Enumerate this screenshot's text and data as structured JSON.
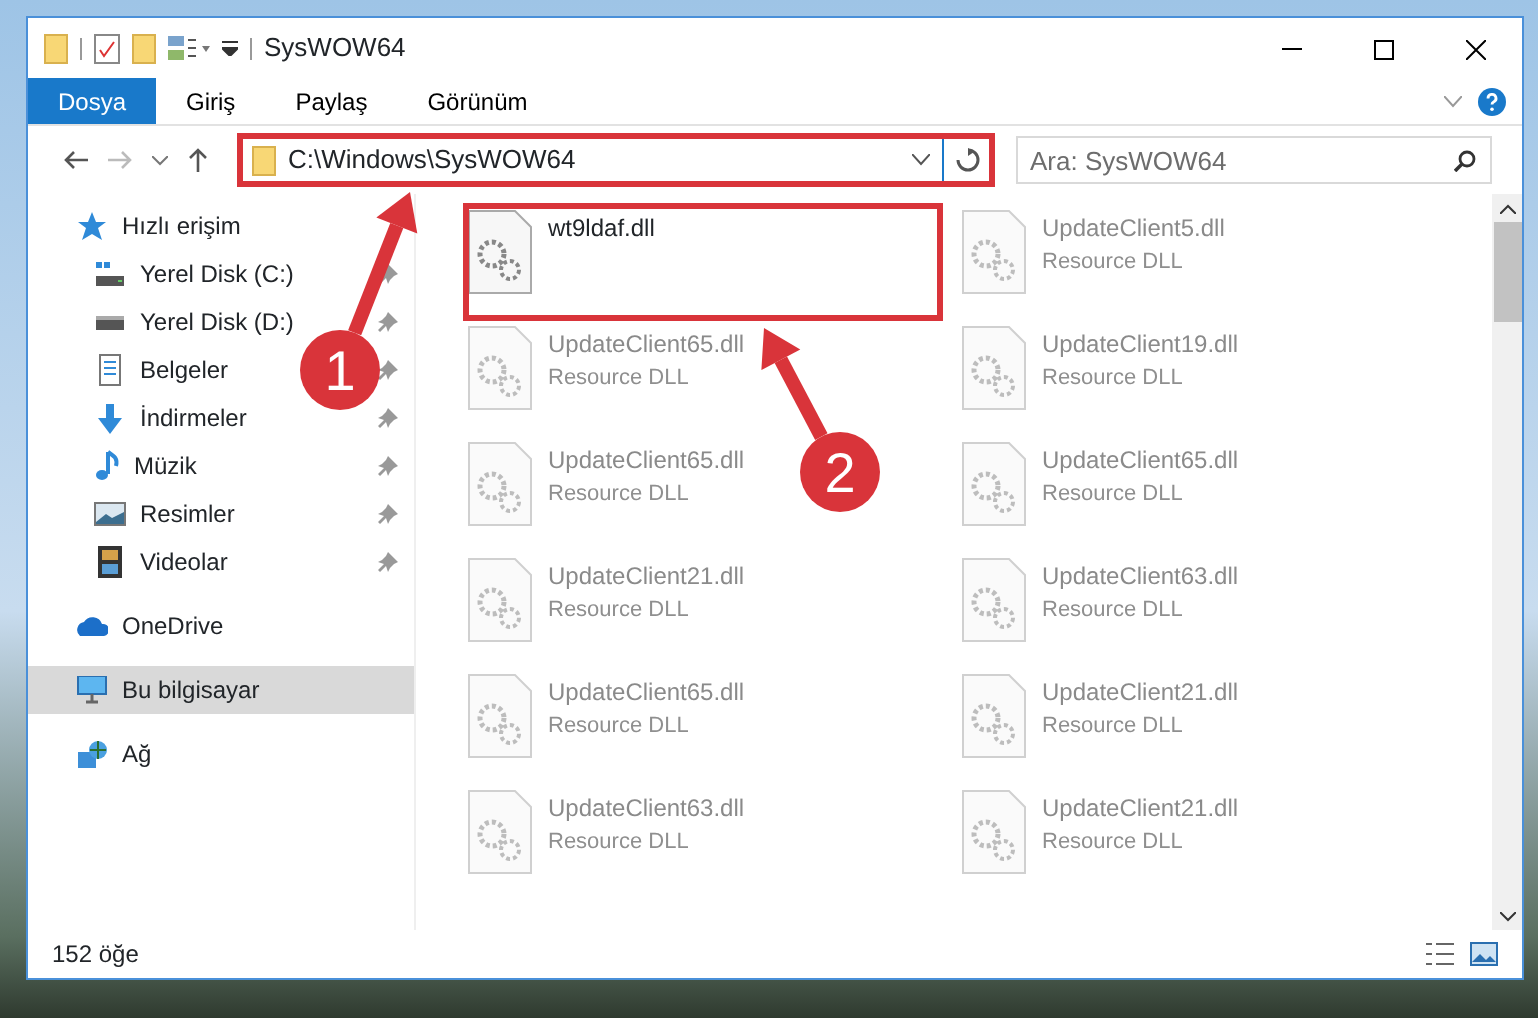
{
  "window": {
    "title": "SysWOW64"
  },
  "ribbon_tabs": [
    {
      "label": "Dosya",
      "selected": true
    },
    {
      "label": "Giriş",
      "selected": false
    },
    {
      "label": "Paylaş",
      "selected": false
    },
    {
      "label": "Görünüm",
      "selected": false
    }
  ],
  "address_bar": {
    "path": "C:\\Windows\\SysWOW64"
  },
  "search": {
    "placeholder": "Ara: SysWOW64"
  },
  "sidebar": {
    "items": [
      {
        "label": "Hızlı erişim",
        "kind": "star",
        "selected": false,
        "children": [
          {
            "label": "Yerel Disk (C:)",
            "kind": "system-drive",
            "pinned": true
          },
          {
            "label": "Yerel Disk (D:)",
            "kind": "drive",
            "pinned": true
          },
          {
            "label": "Belgeler",
            "kind": "documents",
            "pinned": true
          },
          {
            "label": "İndirmeler",
            "kind": "downloads",
            "pinned": true
          },
          {
            "label": "Müzik",
            "kind": "music",
            "pinned": true
          },
          {
            "label": "Resimler",
            "kind": "pictures",
            "pinned": true
          },
          {
            "label": "Videolar",
            "kind": "videos",
            "pinned": true
          }
        ]
      },
      {
        "label": "OneDrive",
        "kind": "cloud",
        "selected": false
      },
      {
        "label": "Bu bilgisayar",
        "kind": "computer",
        "selected": true
      },
      {
        "label": "Ağ",
        "kind": "network",
        "selected": false
      }
    ]
  },
  "files": [
    {
      "name": "wt9ldaf.dll",
      "faded": false
    },
    {
      "name": "UpdateClient5.dll",
      "type": "Resource DLL",
      "faded": true
    },
    {
      "name": "UpdateClient65.dll",
      "type": "Resource DLL",
      "faded": true
    },
    {
      "name": "UpdateClient19.dll",
      "type": "Resource DLL",
      "faded": true
    },
    {
      "name": "UpdateClient65.dll",
      "type": "Resource DLL",
      "faded": true
    },
    {
      "name": "UpdateClient65.dll",
      "type": "Resource DLL",
      "faded": true
    },
    {
      "name": "UpdateClient21.dll",
      "type": "Resource DLL",
      "faded": true
    },
    {
      "name": "UpdateClient63.dll",
      "type": "Resource DLL",
      "faded": true
    },
    {
      "name": "UpdateClient65.dll",
      "type": "Resource DLL",
      "faded": true
    },
    {
      "name": "UpdateClient21.dll",
      "type": "Resource DLL",
      "faded": true
    },
    {
      "name": "UpdateClient63.dll",
      "type": "Resource DLL",
      "faded": true
    },
    {
      "name": "UpdateClient21.dll",
      "type": "Resource DLL",
      "faded": true
    }
  ],
  "status_bar": {
    "count": "152 öğe"
  },
  "callouts": [
    {
      "label": "1"
    },
    {
      "label": "2"
    }
  ]
}
